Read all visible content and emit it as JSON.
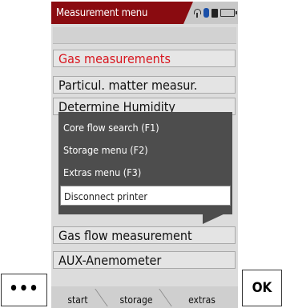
{
  "title": "Measurement menu",
  "status_icons": [
    "signal-icon",
    "bluetooth-icon",
    "battery-full-icon",
    "battery-icon"
  ],
  "menu": {
    "items": [
      {
        "label": "Gas measurements",
        "selected": true
      },
      {
        "label": "Particul. matter measur."
      },
      {
        "label": "Determine Humidity"
      },
      {
        "label": "Gas flow measurement"
      },
      {
        "label": "AUX-Anemometer"
      }
    ]
  },
  "popup": {
    "items": [
      {
        "label": "Core flow search (F1)"
      },
      {
        "label": "Storage menu (F2)"
      },
      {
        "label": "Extras menu (F3)"
      },
      {
        "label": "Disconnect printer",
        "active": true
      }
    ]
  },
  "softkeys": [
    "start",
    "storage",
    "extras"
  ],
  "hardware": {
    "left_label": "•••",
    "right_label": "OK"
  }
}
